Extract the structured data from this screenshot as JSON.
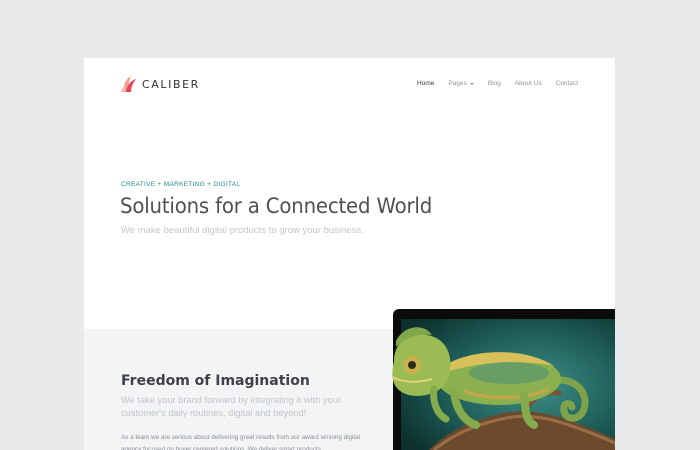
{
  "brand": {
    "name": "CALIBER"
  },
  "nav": {
    "items": [
      {
        "label": "Home",
        "active": true
      },
      {
        "label": "Pages",
        "dropdown": true
      },
      {
        "label": "Blog"
      },
      {
        "label": "About Us"
      },
      {
        "label": "Contact"
      }
    ]
  },
  "hero": {
    "eyebrow": "CREATIVE + MARKETING + DIGITAL",
    "title": "Solutions for a Connected World",
    "subtitle": "We make beautiful digital products to grow your business."
  },
  "feature": {
    "title": "Freedom of Imagination",
    "lead": "We take your brand forward by integrating it with your customer's daily routines, digital and beyond!",
    "body": "As a team we are serious about delivering great results from our award winning digital agency focused on buyer centered solutions. We deliver smart products,"
  },
  "colors": {
    "accent": "#1e8c88",
    "page_background": "#e8e9ea",
    "section_background": "#f3f4f5",
    "logo_primary": "#e8425a",
    "logo_secondary": "#f29a8e"
  },
  "icons": {
    "logo": "caliber-leaf-logo",
    "dropdown": "caret-down-icon"
  }
}
